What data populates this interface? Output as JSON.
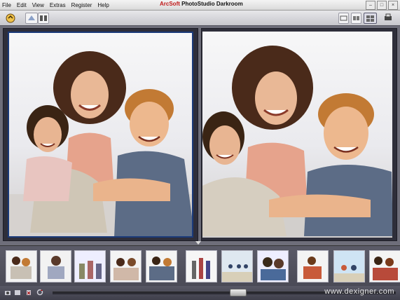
{
  "menu": [
    "File",
    "Edit",
    "View",
    "Extras",
    "Register",
    "Help"
  ],
  "brand": {
    "company": "ArcSoft",
    "product": "PhotoStudio Darkroom"
  },
  "window_controls": [
    "minimize",
    "maximize",
    "close"
  ],
  "toolbar": {
    "left_icons": [
      "open-folder-icon",
      "enhance-icon",
      "compare-icon"
    ],
    "right_icons": [
      "single-view-icon",
      "side-by-side-icon",
      "grid-view-icon",
      "print-icon"
    ]
  },
  "panes": [
    {
      "name": "original",
      "selected": true
    },
    {
      "name": "edited",
      "selected": false
    }
  ],
  "filmstrip_count": 11,
  "status_icons": [
    "camera-icon",
    "album-icon",
    "delete-icon",
    "rotate-icon"
  ],
  "watermark": "www.dexigner.com",
  "colors": {
    "selection": "#1a3a7a",
    "brand_red": "#c01818",
    "panel_bg": "#2e2e3a"
  }
}
